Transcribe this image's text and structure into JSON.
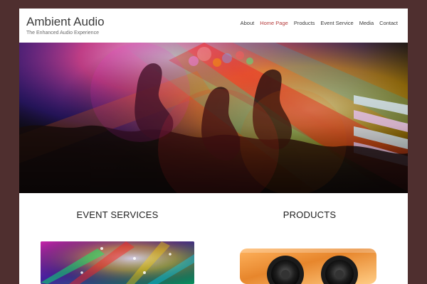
{
  "site": {
    "title": "Ambient Audio",
    "tagline": "The Enhanced Audio Experience"
  },
  "nav": {
    "items": [
      {
        "label": "About",
        "active": false
      },
      {
        "label": "Home Page",
        "active": true
      },
      {
        "label": "Products",
        "active": false
      },
      {
        "label": "Event Service",
        "active": false
      },
      {
        "label": "Media",
        "active": false
      },
      {
        "label": "Contact",
        "active": false
      }
    ]
  },
  "hero": {
    "icon": "concert-hands-image"
  },
  "sections": {
    "left": {
      "title": "EVENT SERVICES",
      "image_icon": "light-show-image"
    },
    "right": {
      "title": "PRODUCTS",
      "image_icon": "speaker-image"
    }
  },
  "colors": {
    "background": "#4f2f2f",
    "accent": "#b43a3a",
    "text": "#3b3b3b"
  }
}
